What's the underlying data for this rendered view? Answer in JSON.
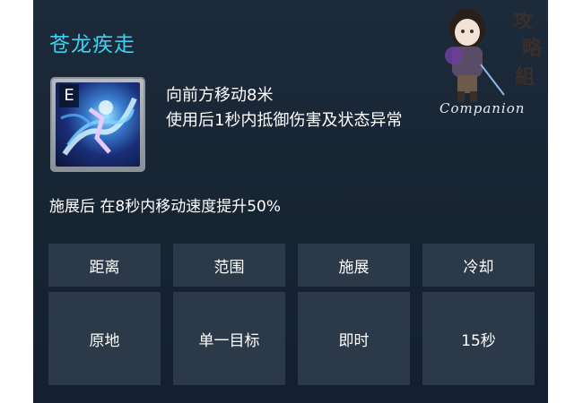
{
  "skill": {
    "name": "苍龙疾走",
    "key": "E",
    "desc_line1": "向前方移动8米",
    "desc_line2": "使用后1秒内抵御伤害及状态异常",
    "effect": "施展后 在8秒内移动速度提升50%"
  },
  "stats": {
    "headers": [
      "距离",
      "范围",
      "施展",
      "冷却"
    ],
    "values": [
      "原地",
      "单一目标",
      "即时",
      "15秒"
    ]
  },
  "watermark": {
    "chars": [
      "攻",
      "略",
      "組"
    ],
    "text": "Companion"
  },
  "colors": {
    "title": "#3fd0f2",
    "panel_bg": "#1a2736",
    "cell_bg": "#2c3948",
    "text": "#ffffff"
  },
  "icons": {
    "skill_icon": "dragon-dash-skill-icon",
    "mascot": "mascot-character-image"
  }
}
